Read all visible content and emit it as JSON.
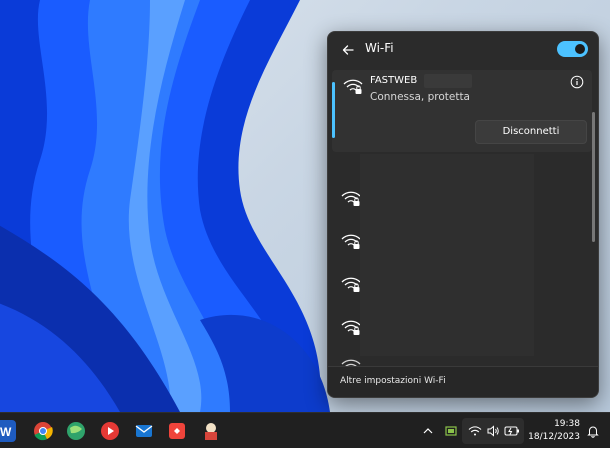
{
  "flyout": {
    "title": "Wi-Fi",
    "toggle_on": true,
    "accent_color": "#4cc2ff",
    "connected": {
      "name": "FASTWEB",
      "status": "Connessa, protetta",
      "disconnect_label": "Disconnetti",
      "icon": "wifi-secured-icon"
    },
    "networks_count_visible": 5,
    "footer_link": "Altre impostazioni Wi-Fi"
  },
  "taskbar": {
    "apps": [
      "word-icon",
      "chrome-icon",
      "web-browser-icon",
      "youtube-icon",
      "mail-icon",
      "anydesk-icon",
      "app-icon"
    ],
    "tray_icons": [
      "chevron-up-icon",
      "app-tray-icon",
      "wifi-icon",
      "volume-icon",
      "battery-icon"
    ],
    "time": "19:38",
    "date": "18/12/2023"
  }
}
